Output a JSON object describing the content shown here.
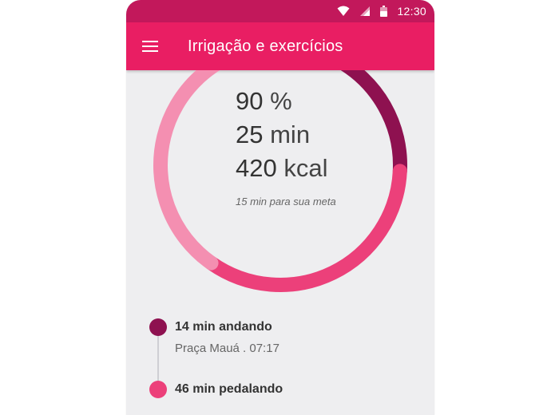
{
  "status_bar": {
    "time": "12:30",
    "icons": [
      "wifi-icon",
      "signal-icon",
      "battery-icon"
    ]
  },
  "app_bar": {
    "menu_icon": "hamburger-menu-icon",
    "title": "Irrigação e exercícios"
  },
  "summary": {
    "percent_value": "90",
    "percent_unit": "%",
    "minutes_value": "25",
    "minutes_unit": "min",
    "calories_value": "420",
    "calories_unit": "kcal",
    "goal_note": "15 min para sua meta"
  },
  "progress_ring": {
    "percent": 90,
    "track_color": "#e4e4e6",
    "segments": [
      {
        "color": "#8e1150",
        "fraction": 0.18
      },
      {
        "color": "#ec407a",
        "fraction": 0.34
      },
      {
        "color": "#f48fb1",
        "fraction": 0.38
      }
    ]
  },
  "activities": [
    {
      "title": "14 min andando",
      "subtitle": "Praça Mauá . 07:17",
      "color": "#8e1150"
    },
    {
      "title": "46 min pedalando",
      "subtitle": "",
      "color": "#ec407a"
    }
  ],
  "colors": {
    "status_bar": "#c2185b",
    "app_bar": "#e91e63",
    "background": "#eeeef0"
  }
}
